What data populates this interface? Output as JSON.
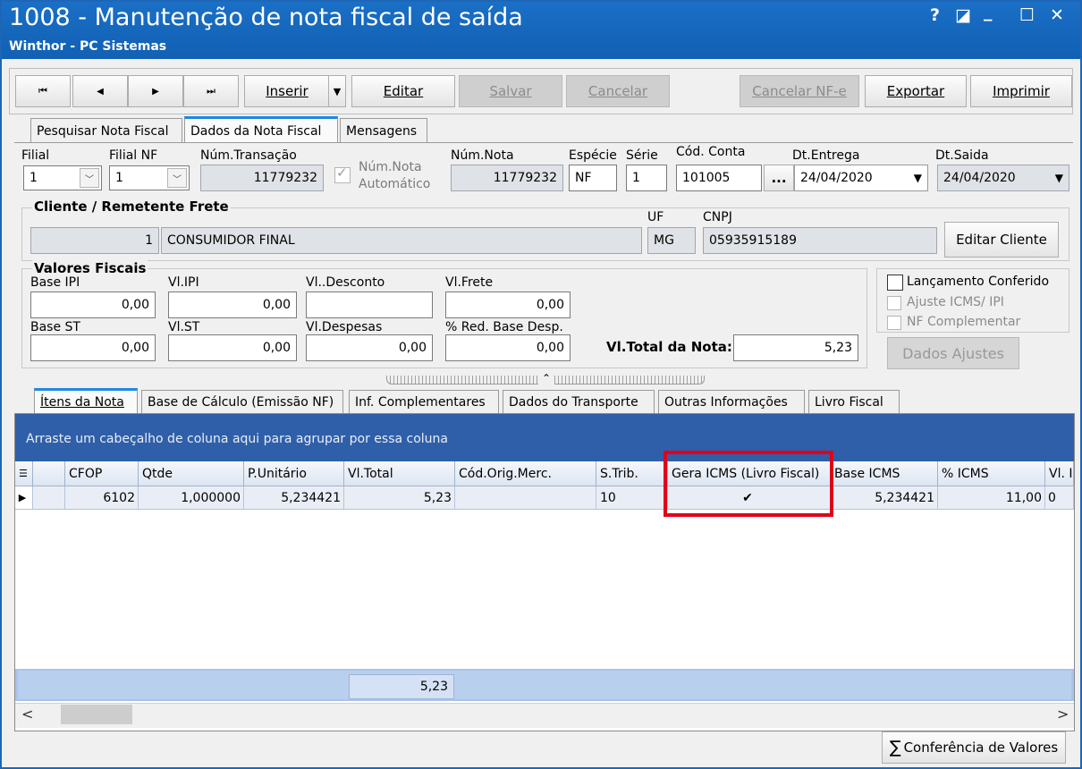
{
  "window": {
    "title": "1008 - Manutenção de nota fiscal de saída",
    "subtitle": "Winthor - PC Sistemas",
    "help": "?",
    "restore": "◪",
    "minimize": "_",
    "maximize": "☐",
    "close": "✕"
  },
  "toolbar": {
    "first": "⏮",
    "prev": "◀",
    "next": "▶",
    "last": "⏭",
    "inserir": "Inserir",
    "inserir_dropdown": "▼",
    "editar": "Editar",
    "salvar": "Salvar",
    "cancelar": "Cancelar",
    "cancelar_nfe": "Cancelar NF-e",
    "exportar": "Exportar",
    "imprimir": "Imprimir"
  },
  "top_tabs": [
    "Pesquisar Nota Fiscal",
    "Dados da Nota Fiscal",
    "Mensagens"
  ],
  "header": {
    "filial_label": "Filial",
    "filial_value": "1",
    "filial_nf_label": "Filial NF",
    "filial_nf_value": "1",
    "num_transacao_label": "Núm.Transação",
    "num_transacao_value": "11779232",
    "num_nota_auto_line1": "Núm.Nota",
    "num_nota_auto_line2": "Automático",
    "num_nota_label": "Núm.Nota",
    "num_nota_value": "11779232",
    "especie_label": "Espécie",
    "especie_value": "NF",
    "serie_label": "Série",
    "serie_value": "1",
    "cod_conta_label": "Cód. Conta",
    "cod_conta_value": "101005",
    "cod_conta_browse": "...",
    "dt_entrega_label": "Dt.Entrega",
    "dt_entrega_value": "24/04/2020",
    "dt_saida_label": "Dt.Saida",
    "dt_saida_value": "24/04/2020"
  },
  "cliente": {
    "group_title": "Cliente / Remetente Frete",
    "codigo": "1",
    "nome": "CONSUMIDOR FINAL",
    "uf_label": "UF",
    "uf_value": "MG",
    "cnpj_label": "CNPJ",
    "cnpj_value": "05935915189",
    "editar_button": "Editar Cliente"
  },
  "valores": {
    "group_title": "Valores Fiscais",
    "base_ipi_label": "Base IPI",
    "base_ipi_value": "0,00",
    "vl_ipi_label": "Vl.IPI",
    "vl_ipi_value": "0,00",
    "vl_desconto_label": "Vl..Desconto",
    "vl_desconto_value": "",
    "vl_frete_label": "Vl.Frete",
    "vl_frete_value": "0,00",
    "base_st_label": "Base ST",
    "base_st_value": "0,00",
    "vl_st_label": "Vl.ST",
    "vl_st_value": "0,00",
    "vl_despesas_label": "Vl.Despesas",
    "vl_despesas_value": "0,00",
    "red_base_label": "% Red. Base Desp.",
    "red_base_value": "0,00",
    "vl_total_label": "Vl.Total da Nota:",
    "vl_total_value": "5,23"
  },
  "options": {
    "lancamento_conferido": "Lançamento Conferido",
    "ajuste_icms": "Ajuste ICMS/ IPI",
    "nf_complementar": "NF Complementar",
    "dados_ajustes": "Dados Ajustes"
  },
  "bottom_tabs": [
    "Ítens da Nota",
    "Base de Cálculo (Emissão NF)",
    "Inf. Complementares",
    "Dados do Transporte",
    "Outras Informações",
    "Livro Fiscal"
  ],
  "grid": {
    "group_hint": "Arraste um cabeçalho de coluna aqui para agrupar por essa coluna",
    "columns": [
      "CFOP",
      "Qtde",
      "P.Unitário",
      "Vl.Total",
      "Cód.Orig.Merc.",
      "S.Trib.",
      "Gera ICMS (Livro Fiscal)",
      "Base ICMS",
      "% ICMS",
      "Vl. I"
    ],
    "row": [
      "6102",
      "1,000000",
      "5,234421",
      "5,23",
      "",
      "10",
      "✔",
      "5,234421",
      "11,00",
      "0"
    ],
    "footer_total": "5,23",
    "scroll_left": "<",
    "scroll_right": ">"
  },
  "footer": {
    "conferencia": "Conferência de Valores",
    "sigma": "∑"
  },
  "colors": {
    "titlebar": "#1565c0",
    "highlight_box": "#e0001b",
    "grid_band": "#2f5fa8"
  }
}
